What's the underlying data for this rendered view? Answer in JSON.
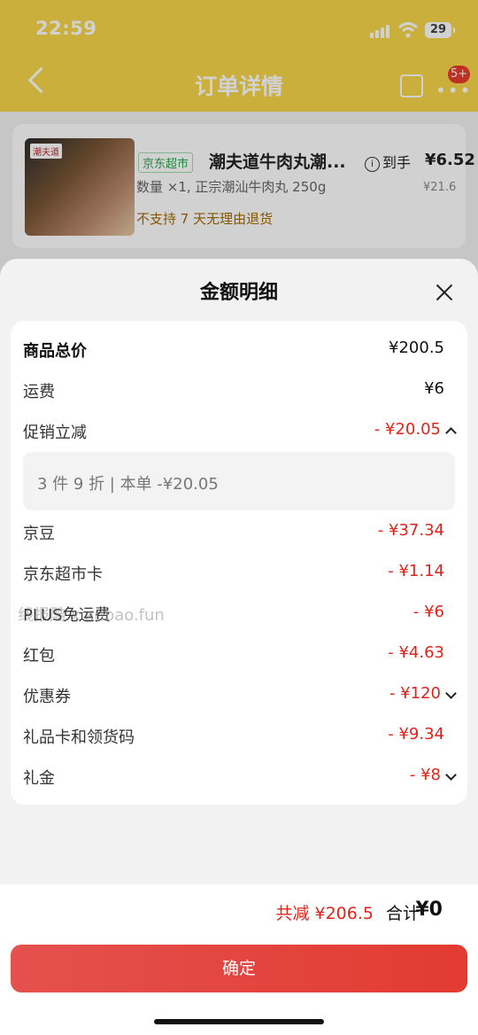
{
  "status_bar": {
    "time": "22:59",
    "battery": "29"
  },
  "nav": {
    "title": "订单详情",
    "badge": "5+"
  },
  "product": {
    "image_tag": "潮夫道",
    "shop_tag": "京东超市",
    "title": "潮夫道牛肉丸潮...",
    "price_label": "到手",
    "price_now": "¥6.52",
    "price_orig": "¥21.6",
    "spec": "数量 ×1, 正宗潮汕牛肉丸 250g",
    "note": "不支持 7 天无理由退货"
  },
  "sheet": {
    "title": "金额明细",
    "rows": [
      {
        "label": "商品总价",
        "value": "¥200.5"
      },
      {
        "label": "运费",
        "value": "¥6"
      },
      {
        "label": "促销立减",
        "value": "- ¥20.05"
      },
      {
        "label": "京豆",
        "value": "- ¥37.34"
      },
      {
        "label": "京东超市卡",
        "value": "- ¥1.14"
      },
      {
        "label": "PLUS免运费",
        "value": "- ¥6"
      },
      {
        "label": "红包",
        "value": "- ¥4.63"
      },
      {
        "label": "优惠券",
        "value": "- ¥120"
      },
      {
        "label": "礼品卡和领货码",
        "value": "- ¥9.34"
      },
      {
        "label": "礼金",
        "value": "- ¥8"
      }
    ],
    "promo_detail": "3 件 9 折 | 本单 -¥20.05",
    "watermark": "线报酷 xianbao.fun"
  },
  "footer": {
    "saved": "共减 ¥206.5",
    "total_label": "合计",
    "total_value": "¥0",
    "confirm": "确定"
  },
  "colors": {
    "accent_red": "#e2231a",
    "header_yellow": "#f7d64a"
  }
}
